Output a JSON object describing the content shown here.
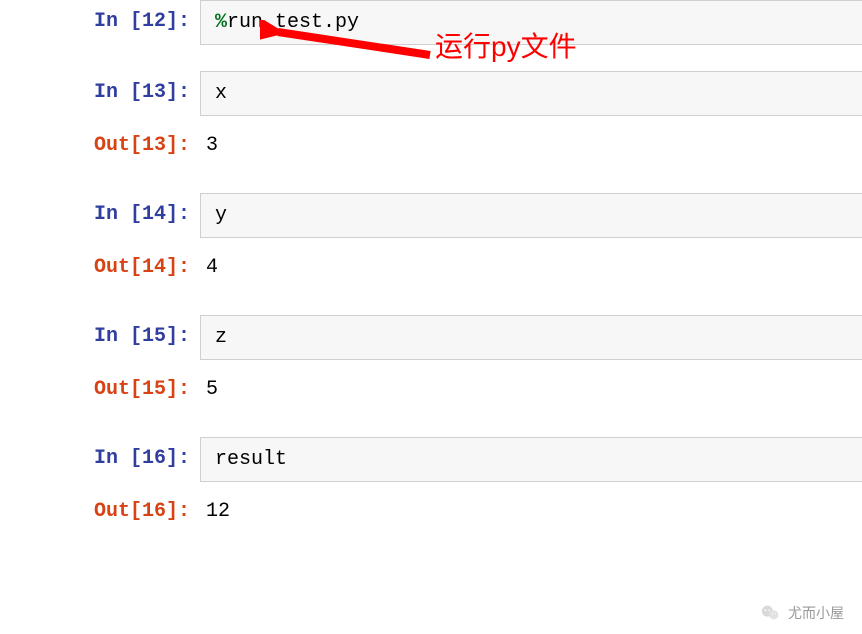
{
  "cells": [
    {
      "type": "in",
      "num": 12,
      "code": "%run test.py",
      "magic_prefix": "%",
      "magic_rest": "run test.py"
    },
    {
      "type": "in",
      "num": 13,
      "code": "x"
    },
    {
      "type": "out",
      "num": 13,
      "value": "3"
    },
    {
      "type": "in",
      "num": 14,
      "code": "y"
    },
    {
      "type": "out",
      "num": 14,
      "value": "4"
    },
    {
      "type": "in",
      "num": 15,
      "code": "z"
    },
    {
      "type": "out",
      "num": 15,
      "value": "5"
    },
    {
      "type": "in",
      "num": 16,
      "code": "result"
    },
    {
      "type": "out",
      "num": 16,
      "value": "12"
    }
  ],
  "prompts": {
    "in12": "In [12]:",
    "in13": "In [13]:",
    "out13": "Out[13]:",
    "in14": "In [14]:",
    "out14": "Out[14]:",
    "in15": "In [15]:",
    "out15": "Out[15]:",
    "in16": "In [16]:",
    "out16": "Out[16]:"
  },
  "code": {
    "c12_magic": "%",
    "c12_rest": "run test.py",
    "c13": "x",
    "c14": "y",
    "c15": "z",
    "c16": "result"
  },
  "outputs": {
    "o13": "3",
    "o14": "4",
    "o15": "5",
    "o16": "12"
  },
  "annotation": {
    "text": "运行py文件",
    "color": "#FF0000"
  },
  "watermark": {
    "text": "尤而小屋"
  }
}
